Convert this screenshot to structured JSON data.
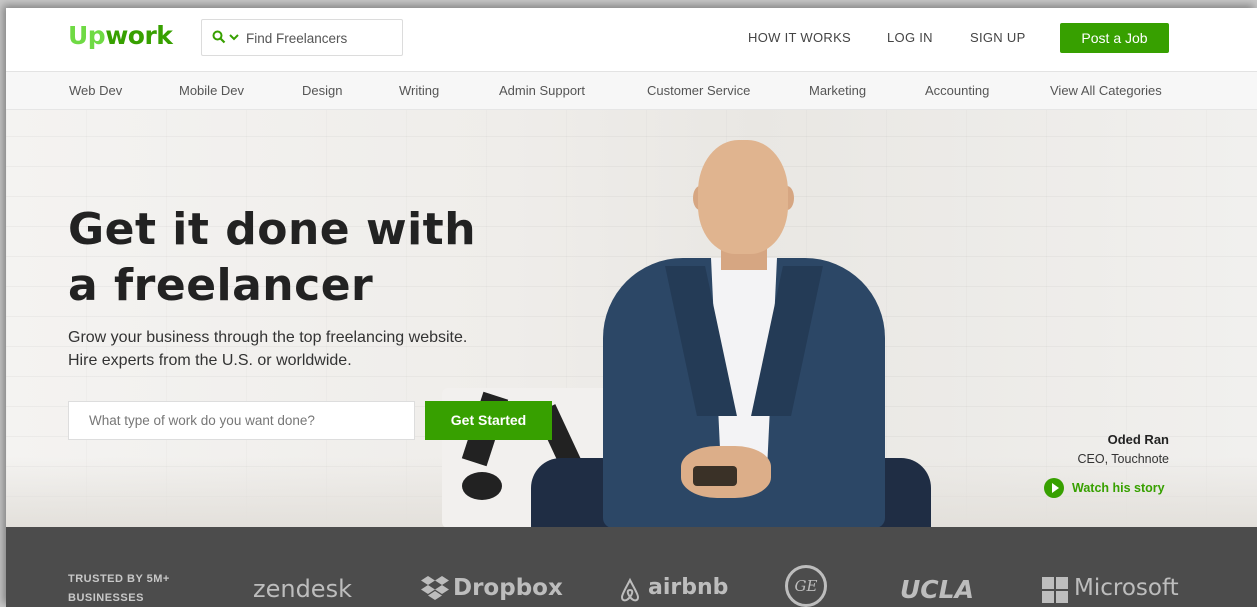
{
  "header": {
    "logo_up": "Up",
    "logo_work": "work",
    "search_placeholder": "Find Freelancers",
    "nav": [
      "HOW IT WORKS",
      "LOG IN",
      "SIGN UP"
    ],
    "post_job": "Post a Job"
  },
  "categories": [
    "Web Dev",
    "Mobile Dev",
    "Design",
    "Writing",
    "Admin Support",
    "Customer Service",
    "Marketing",
    "Accounting",
    "View All Categories"
  ],
  "hero": {
    "headline_line1": "Get it done with",
    "headline_line2": "a freelancer",
    "subline": "Grow your business through the top freelancing website. Hire experts from the U.S. or worldwide.",
    "input_placeholder": "What type of work do you want done?",
    "cta": "Get Started",
    "person_name": "Oded Ran",
    "person_role": "CEO, Touchnote",
    "watch_label": "Watch his story"
  },
  "trusted": {
    "label": "TRUSTED BY 5M+ BUSINESSES",
    "brands": [
      "zendesk",
      "Dropbox",
      "airbnb",
      "GE",
      "UCLA",
      "Microsoft"
    ]
  },
  "colors": {
    "brand_green": "#37a000",
    "logo_light_green": "#6fda44",
    "trusted_bg": "#4c4c4c"
  },
  "icons": [
    "search-icon",
    "chevron-down-icon",
    "play-icon",
    "dropbox-icon",
    "airbnb-icon",
    "microsoft-icon"
  ]
}
